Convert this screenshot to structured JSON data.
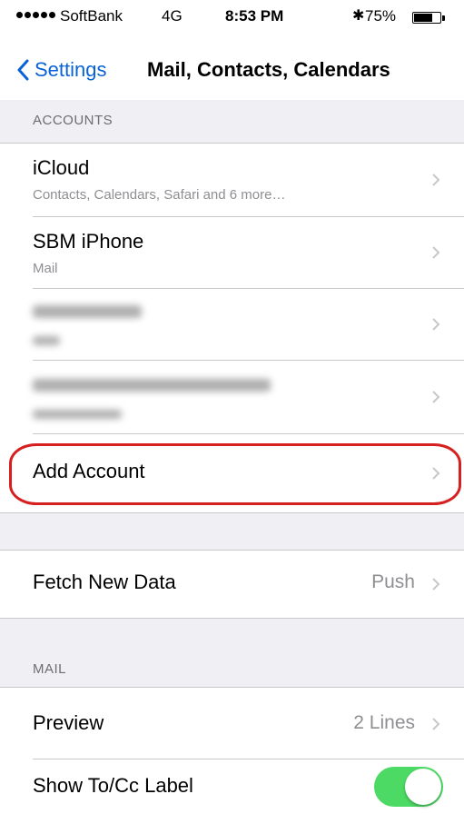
{
  "status_bar": {
    "carrier": "SoftBank",
    "network": "4G",
    "time": "8:53 PM",
    "bluetooth_icon": "bluetooth-icon",
    "battery_percent": "75%",
    "battery_level": 0.75
  },
  "nav": {
    "back_label": "Settings",
    "title": "Mail, Contacts, Calendars"
  },
  "accounts_section": {
    "header": "ACCOUNTS",
    "items": [
      {
        "title": "iCloud",
        "subtitle": "Contacts, Calendars, Safari and 6 more…"
      },
      {
        "title": "SBM iPhone",
        "subtitle": "Mail"
      }
    ],
    "add_account_label": "Add Account"
  },
  "fetch": {
    "label": "Fetch New Data",
    "value": "Push"
  },
  "mail_section": {
    "header": "MAIL",
    "preview_label": "Preview",
    "preview_value": "2 Lines",
    "show_tocc_label": "Show To/Cc Label",
    "show_tocc_on": true
  },
  "colors": {
    "accent": "#0a63d6",
    "group_bg": "#efeff4",
    "toggle_on": "#4cd964",
    "highlight": "#d62020"
  }
}
